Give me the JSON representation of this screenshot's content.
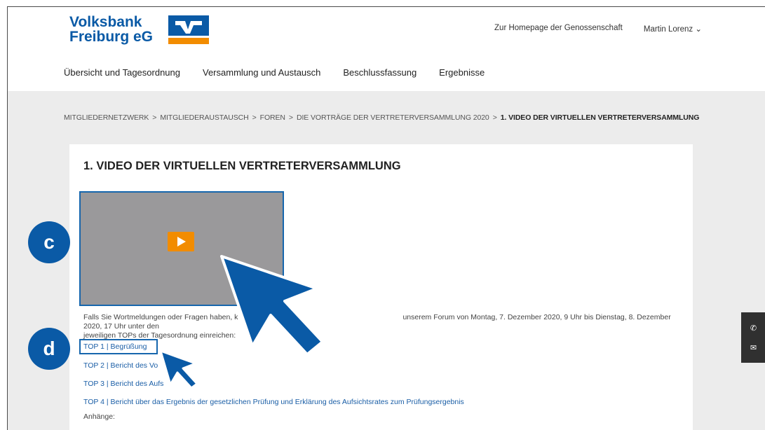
{
  "brand": {
    "line1": "Volksbank",
    "line2": "Freiburg eG",
    "colors": {
      "primary": "#0a5aa6",
      "accent": "#f28c00"
    }
  },
  "header_links": {
    "homepage": "Zur Homepage der Genossenschaft",
    "user": "Martin Lorenz ⌄"
  },
  "nav": {
    "items": [
      "Übersicht und Tagesordnung",
      "Versammlung und Austausch",
      "Beschlussfassung",
      "Ergebnisse"
    ]
  },
  "breadcrumb": {
    "items": [
      "MITGLIEDERNETZWERK",
      "MITGLIEDERAUSTAUSCH",
      "FOREN",
      "DIE VORTRÄGE DER VERTRETERVERSAMMLUNG 2020"
    ],
    "separator": ">",
    "current": "1. VIDEO DER VIRTUELLEN VERTRETERVERSAMMLUNG"
  },
  "page": {
    "title": "1. VIDEO DER VIRTUELLEN VERTRETERVERSAMMLUNG",
    "intro_part1": "Falls Sie Wortmeldungen oder Fragen haben, k",
    "intro_part2": "unserem Forum von Montag, 7. Dezember 2020, 9 Uhr bis Dienstag, 8. Dezember 2020, 17 Uhr unter den",
    "intro_line2": "jeweiligen TOPs der Tagesordnung einreichen:",
    "tops": [
      "TOP 1 | Begrüßung",
      "TOP 2 | Bericht des Vo",
      "TOP 3 | Bericht des Aufs",
      "TOP 4 | Bericht über das Ergebnis der gesetzlichen Prüfung und Erklärung des Aufsichtsrates zum Prüfungsergebnis"
    ],
    "attachments_label": "Anhänge:"
  },
  "annotations": {
    "badge_c": "c",
    "badge_d": "d"
  },
  "side_contact": {
    "phone_icon": "✆",
    "mail_icon": "✉"
  }
}
